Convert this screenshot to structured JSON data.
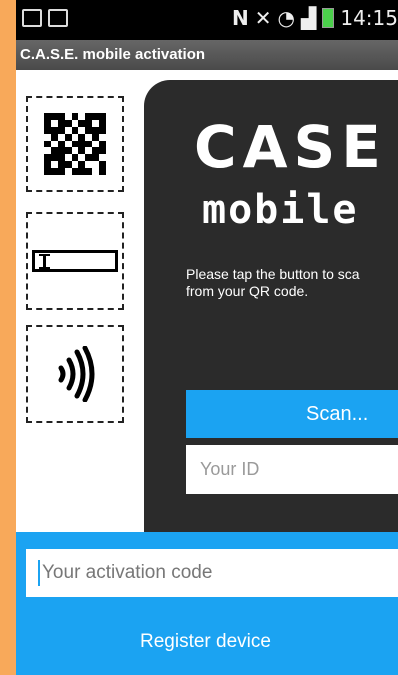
{
  "status_bar": {
    "time": "14:15",
    "icons": [
      "image-notification-icon",
      "bag-notification-icon",
      "nfc-icon",
      "mute-icon",
      "wifi-icon",
      "signal-icon",
      "battery-icon"
    ]
  },
  "app": {
    "title": "C.A.S.E. mobile activation"
  },
  "sidebar": {
    "items": [
      {
        "icon": "qr-code-icon"
      },
      {
        "icon": "text-field-icon"
      },
      {
        "icon": "nfc-contactless-icon"
      }
    ]
  },
  "panel": {
    "logo_line1": "CASE",
    "logo_line2": "mobile",
    "info_text_line1": "Please tap the button to sca",
    "info_text_line2": "from your QR code.",
    "scan_label": "Scan...",
    "id_placeholder": "Your ID"
  },
  "footer": {
    "activation_placeholder": "Your activation code",
    "register_label": "Register device"
  },
  "colors": {
    "accent": "#1ba3f2",
    "panel": "#2b2b2b",
    "background": "#f8a95a"
  }
}
